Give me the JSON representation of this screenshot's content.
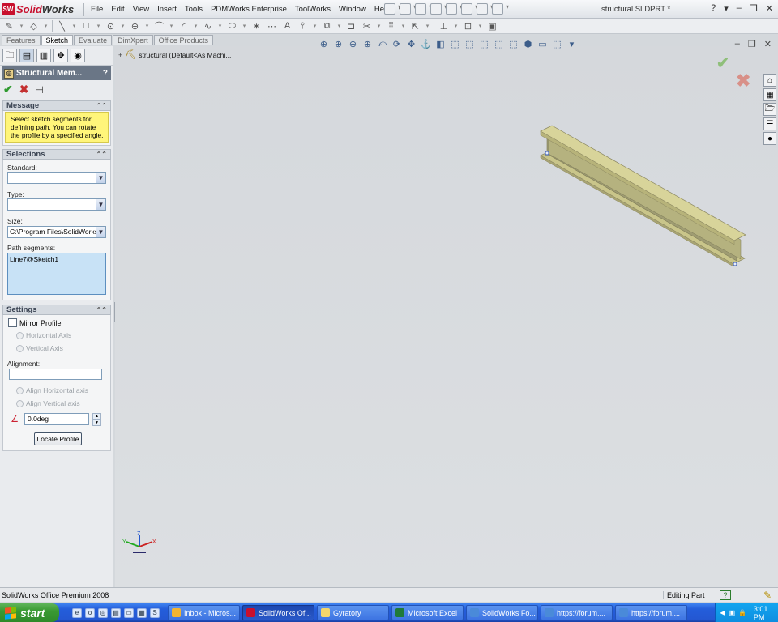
{
  "app": {
    "brand_prefix": "Solid",
    "brand_suffix": "Works",
    "logo_badge": "SW",
    "document_title": "structural.SLDPRT *",
    "menu": [
      "File",
      "Edit",
      "View",
      "Insert",
      "Tools",
      "PDMWorks Enterprise",
      "ToolWorks",
      "Window",
      "Help"
    ],
    "window_controls": [
      "?",
      "▾",
      "–",
      "❐",
      "✕"
    ]
  },
  "command_tabs": [
    "Features",
    "Sketch",
    "Evaluate",
    "DimXpert",
    "Office Products"
  ],
  "active_tab": "Sketch",
  "property_manager": {
    "title": "Structural Mem...",
    "help": "?",
    "message_header": "Message",
    "message_text": "Select sketch segments for defining path. You can rotate the profile by a specified angle.",
    "selections_header": "Selections",
    "standard_label": "Standard:",
    "standard_value": "",
    "type_label": "Type:",
    "type_value": "",
    "size_label": "Size:",
    "size_value": "C:\\Program Files\\SolidWorks",
    "path_label": "Path segments:",
    "path_segments": [
      "Line7@Sketch1"
    ],
    "settings_header": "Settings",
    "mirror_profile_label": "Mirror Profile",
    "horizontal_axis_label": "Horizontal Axis",
    "vertical_axis_label": "Vertical Axis",
    "alignment_label": "Alignment:",
    "alignment_value": "",
    "align_horizontal_label": "Align Horizontal axis",
    "align_vertical_label": "Align Vertical axis",
    "angle_value": "0.0deg",
    "locate_profile_label": "Locate Profile"
  },
  "feature_tree": {
    "part_label": "structural  (Default<As Machi..."
  },
  "triad_labels": {
    "x": "X",
    "y": "Y",
    "z": "Z"
  },
  "status": {
    "left_text": "SolidWorks Office Premium 2008",
    "mode": "Editing Part",
    "help_icon": "?"
  },
  "taskbar": {
    "start_label": "start",
    "tasks": [
      {
        "label": "Inbox - Micros...",
        "icon_color": "#f2b431",
        "active": false
      },
      {
        "label": "SolidWorks Of...",
        "icon_color": "#c8102e",
        "active": true
      },
      {
        "label": "Gyratory",
        "icon_color": "#f4d66a",
        "active": false
      },
      {
        "label": "Microsoft Excel",
        "icon_color": "#1f7a3a",
        "active": false
      },
      {
        "label": "SolidWorks Fo...",
        "icon_color": "#4a8ad9",
        "active": false
      },
      {
        "label": "https://forum....",
        "icon_color": "#4a8ad9",
        "active": false
      },
      {
        "label": "https://forum....",
        "icon_color": "#4a8ad9",
        "active": false
      }
    ],
    "clock": "3:01 PM"
  },
  "colors": {
    "beam_top": "#d8d49a",
    "beam_side": "#b7b37a",
    "beam_web": "#9f9c72",
    "message_bg": "#fff57a",
    "path_bg": "#c8e2f6"
  }
}
